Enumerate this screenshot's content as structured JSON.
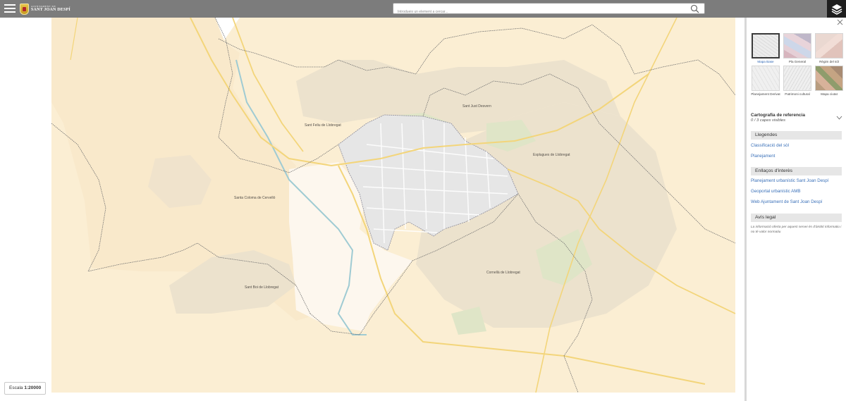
{
  "header": {
    "logo_small": "AJUNTAMENT DE",
    "logo_big": "SANT JOAN DESPÍ",
    "search_placeholder": "Introdueix un element a cercar..."
  },
  "map": {
    "labels": [
      "Sant Just Desvern",
      "Sant Feliu de Llobregat",
      "Esplugues de Llobregat",
      "Santa Coloma de Cervelló",
      "Sant Boi de Llobregat",
      "Cornellà de Llobregat"
    ],
    "scale_prefix": "Escala",
    "scale_value": "1:20000",
    "colors": {
      "background": "#fbeed3",
      "urban": "#ece2cd",
      "municipality": "#e8e8e8",
      "green": "#dfe5c7",
      "river": "#9fcbd3",
      "roads": "#f3d57a"
    }
  },
  "panel": {
    "basemaps": [
      {
        "label": "Mapa Base"
      },
      {
        "label": "Pla General"
      },
      {
        "label": "Règim del sòl"
      },
      {
        "label": "Planejament Derivat"
      },
      {
        "label": "Patrimoni cultural"
      },
      {
        "label": "Mapa ciutat"
      }
    ],
    "cartografia": {
      "title": "Cartografia de referencia",
      "subtitle": "0 / 3 capes visibles"
    },
    "legendes": {
      "title": "Llegendes",
      "links": [
        "Classificació del sòl",
        "Planejament"
      ]
    },
    "enllacos": {
      "title": "Enllaços d'interès",
      "links": [
        "Planejament urbanístic Sant Joan Despí",
        "Geoportal urbanístic AMB",
        "Web Ajuntament de Sant Joan Despí"
      ]
    },
    "avis": {
      "title": "Avís legal",
      "text": "La informació oferta per aquest servei és d'àmbit informatiu i no té valor normatiu"
    }
  }
}
